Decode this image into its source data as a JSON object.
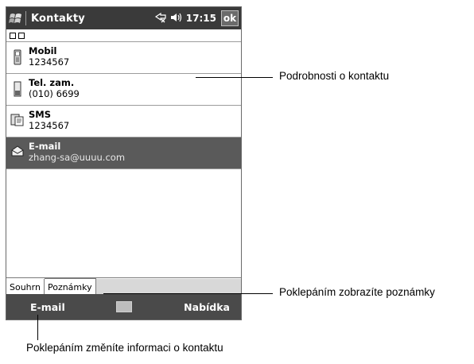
{
  "titlebar": {
    "title": "Kontakty",
    "time": "17:15",
    "ok_label": "ok"
  },
  "contact_fields": [
    {
      "label": "Mobil",
      "value": "1234567",
      "icon": "mobile-phone-icon"
    },
    {
      "label": "Tel. zam.",
      "value": "(010) 6699",
      "icon": "work-phone-icon"
    },
    {
      "label": "SMS",
      "value": "1234567",
      "icon": "sms-icon"
    },
    {
      "label": "E-mail",
      "value": "zhang-sa@uuuu.com",
      "icon": "email-icon",
      "selected": true
    }
  ],
  "tabs": [
    {
      "label": "Souhrn"
    },
    {
      "label": "Poznámky"
    }
  ],
  "menubar": {
    "left": "E-mail",
    "right": "Nabídka"
  },
  "annotations": {
    "details": "Podrobnosti o kontaktu",
    "notes": "Poklepáním zobrazíte poznámky",
    "edit": "Poklepáním změníte informaci o kontaktu"
  },
  "colors": {
    "titlebar_bg": "#3a3a3a",
    "menubar_bg": "#4a4a4a",
    "selection_bg": "#5a5a5a"
  }
}
